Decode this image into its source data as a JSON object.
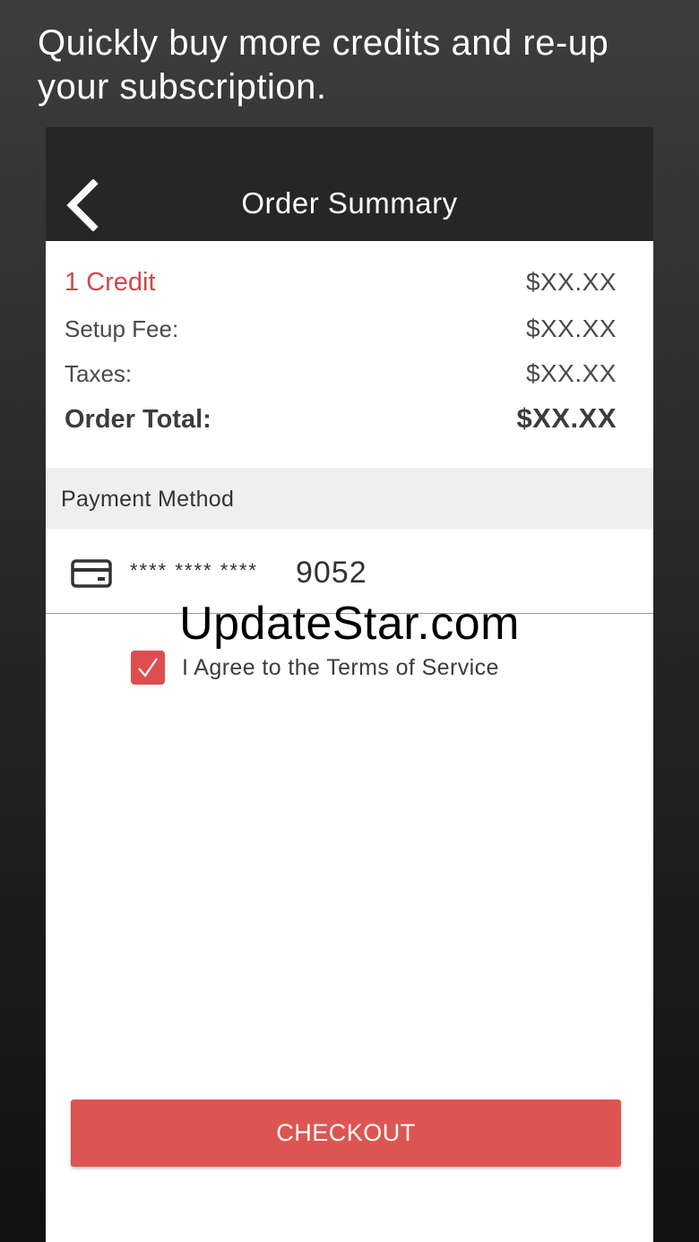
{
  "promo": {
    "line1": "Quickly buy more credits and re-up",
    "line2": "your subscription."
  },
  "header": {
    "back_icon": "chevron-left-icon",
    "title": "Order Summary"
  },
  "order": {
    "credit_label": "1 Credit",
    "credit_price": "$XX.XX",
    "setup_label": "Setup Fee:",
    "setup_price": "$XX.XX",
    "taxes_label": "Taxes:",
    "taxes_price": "$XX.XX",
    "total_label": "Order Total:",
    "total_price": "$XX.XX"
  },
  "payment": {
    "header": "Payment Method",
    "card_icon": "credit-card-icon",
    "card_mask": "**** **** ****",
    "card_last4": "9052"
  },
  "watermark": "UpdateStar.com",
  "terms": {
    "checked": true,
    "label": "I Agree to the Terms of Service"
  },
  "checkout_label": "CHECKOUT",
  "colors": {
    "accent": "#dd5552",
    "topbar": "#262626",
    "credit_text": "#d0484a",
    "section_bg": "#efefef"
  }
}
